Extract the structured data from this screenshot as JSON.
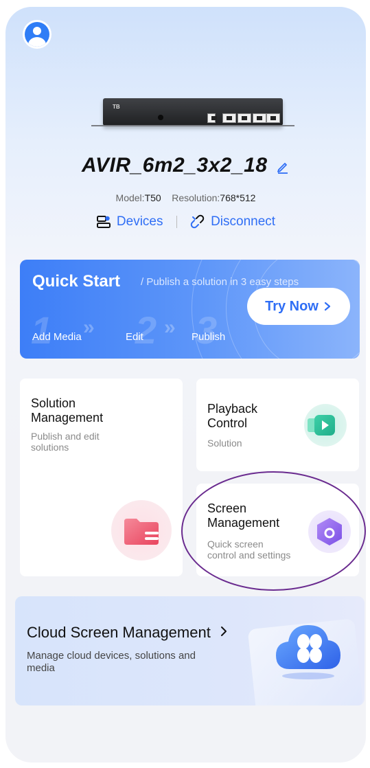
{
  "device": {
    "label": "TB",
    "name": "AVIR_6m2_3x2_18",
    "model_label": "Model:",
    "model_value": "T50",
    "resolution_label": "Resolution:",
    "resolution_value": "768*512"
  },
  "actions": {
    "devices_label": "Devices",
    "disconnect_label": "Disconnect"
  },
  "quick_start": {
    "title": "Quick Start",
    "subtitle": "/ Publish a solution in 3 easy steps",
    "button_label": "Try Now",
    "steps": [
      {
        "number": "1",
        "label": "Add Media"
      },
      {
        "number": "2",
        "label": "Edit"
      },
      {
        "number": "3",
        "label": "Publish"
      }
    ]
  },
  "cards": {
    "solution": {
      "title_line1": "Solution",
      "title_line2": "Management",
      "desc_line1": "Publish and edit",
      "desc_line2": "solutions"
    },
    "playback": {
      "title_line1": "Playback",
      "title_line2": "Control",
      "desc_line1": "Solution"
    },
    "screen": {
      "title_line1": "Screen",
      "title_line2": "Management",
      "desc_line1": "Quick screen",
      "desc_line2": "control and settings"
    }
  },
  "cloud": {
    "title": "Cloud Screen Management",
    "desc_line1": "Manage cloud devices, solutions and",
    "desc_line2": "media"
  },
  "colors": {
    "accent": "#2f6ef5",
    "annotation": "#6a2b8f"
  },
  "icons": [
    "user-avatar-icon",
    "edit-icon",
    "devices-icon",
    "disconnect-icon",
    "chevron-right-icon",
    "folder-icon",
    "play-icon",
    "settings-hex-icon",
    "cloud-icon"
  ]
}
